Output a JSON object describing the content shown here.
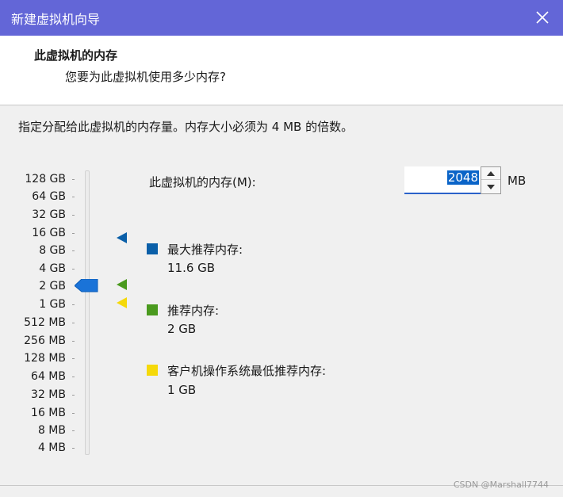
{
  "window": {
    "title": "新建虚拟机向导"
  },
  "header": {
    "title": "此虚拟机的内存",
    "subtitle": "您要为此虚拟机使用多少内存?"
  },
  "instruction": "指定分配给此虚拟机的内存量。内存大小必须为 4 MB 的倍数。",
  "slider": {
    "labels": [
      "128 GB",
      "64 GB",
      "32 GB",
      "16 GB",
      "8 GB",
      "4 GB",
      "2 GB",
      "1 GB",
      "512 MB",
      "256 MB",
      "128 MB",
      "64 MB",
      "32 MB",
      "16 MB",
      "8 MB",
      "4 MB"
    ],
    "current_value": "2 GB"
  },
  "memory": {
    "label": "此虚拟机的内存(M):",
    "value": "2048",
    "unit": "MB"
  },
  "legend": {
    "max": {
      "label": "最大推荐内存:",
      "value": "11.6 GB",
      "color": "#0a5fa8"
    },
    "recommended": {
      "label": "推荐内存:",
      "value": "2 GB",
      "color": "#4a9a1e"
    },
    "minimum": {
      "label": "客户机操作系统最低推荐内存:",
      "value": "1 GB",
      "color": "#f5d90a"
    }
  },
  "icons": {
    "close": "close-icon",
    "spin_up": "chevron-up-icon",
    "spin_down": "chevron-down-icon"
  },
  "colors": {
    "titlebar": "#6366d7",
    "thumb": "#1a73d8",
    "selection": "#0a64c8"
  },
  "watermark": "CSDN @Marshall7744"
}
